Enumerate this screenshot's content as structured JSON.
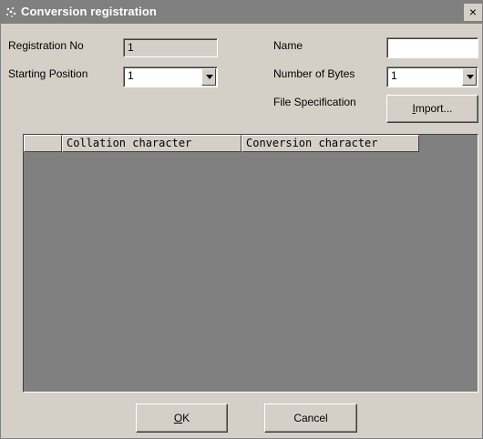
{
  "window": {
    "title": "Conversion registration",
    "close_glyph": "×",
    "icon": "app-icon"
  },
  "form": {
    "registration_no_label": "Registration No",
    "registration_no_value": "1",
    "starting_position_label": "Starting Position",
    "starting_position_value": "1",
    "name_label": "Name",
    "name_value": "",
    "number_of_bytes_label": "Number of Bytes",
    "number_of_bytes_value": "1",
    "file_specification_label": "File Specification",
    "import_button": {
      "mnemonic": "I",
      "rest": "mport..."
    }
  },
  "table": {
    "columns": [
      "",
      "Collation character",
      "Conversion character"
    ],
    "rows": []
  },
  "buttons": {
    "ok": {
      "mnemonic": "O",
      "rest": "K"
    },
    "cancel": "Cancel"
  }
}
